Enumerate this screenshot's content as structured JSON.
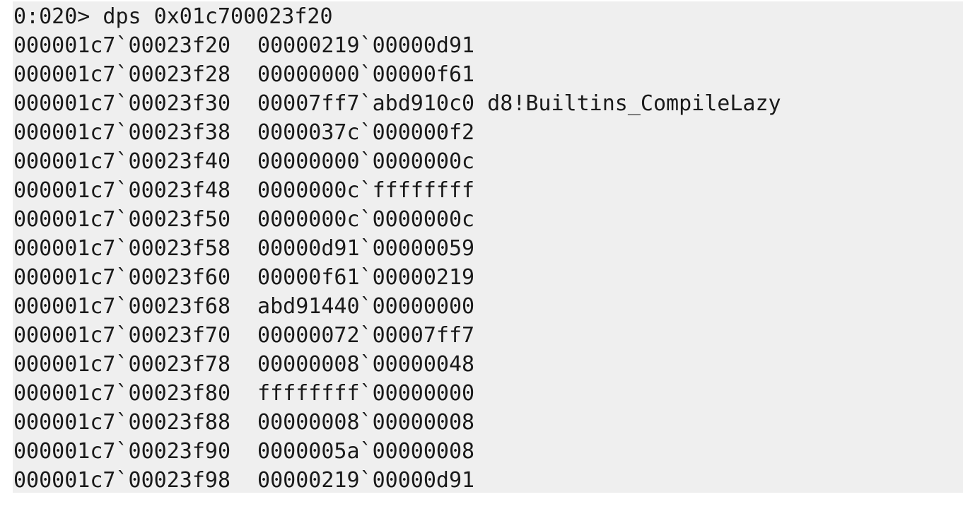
{
  "terminal": {
    "prompt": "0:020> dps 0x01c700023f20",
    "rows": [
      {
        "addr": "000001c7`00023f20",
        "value": "00000219`00000d91",
        "symbol": ""
      },
      {
        "addr": "000001c7`00023f28",
        "value": "00000000`00000f61",
        "symbol": ""
      },
      {
        "addr": "000001c7`00023f30",
        "value": "00007ff7`abd910c0",
        "symbol": "d8!Builtins_CompileLazy"
      },
      {
        "addr": "000001c7`00023f38",
        "value": "0000037c`000000f2",
        "symbol": ""
      },
      {
        "addr": "000001c7`00023f40",
        "value": "00000000`0000000c",
        "symbol": ""
      },
      {
        "addr": "000001c7`00023f48",
        "value": "0000000c`ffffffff",
        "symbol": ""
      },
      {
        "addr": "000001c7`00023f50",
        "value": "0000000c`0000000c",
        "symbol": ""
      },
      {
        "addr": "000001c7`00023f58",
        "value": "00000d91`00000059",
        "symbol": ""
      },
      {
        "addr": "000001c7`00023f60",
        "value": "00000f61`00000219",
        "symbol": ""
      },
      {
        "addr": "000001c7`00023f68",
        "value": "abd91440`00000000",
        "symbol": ""
      },
      {
        "addr": "000001c7`00023f70",
        "value": "00000072`00007ff7",
        "symbol": ""
      },
      {
        "addr": "000001c7`00023f78",
        "value": "00000008`00000048",
        "symbol": ""
      },
      {
        "addr": "000001c7`00023f80",
        "value": "ffffffff`00000000",
        "symbol": ""
      },
      {
        "addr": "000001c7`00023f88",
        "value": "00000008`00000008",
        "symbol": ""
      },
      {
        "addr": "000001c7`00023f90",
        "value": "0000005a`00000008",
        "symbol": ""
      },
      {
        "addr": "000001c7`00023f98",
        "value": "00000219`00000d91",
        "symbol": ""
      }
    ]
  }
}
